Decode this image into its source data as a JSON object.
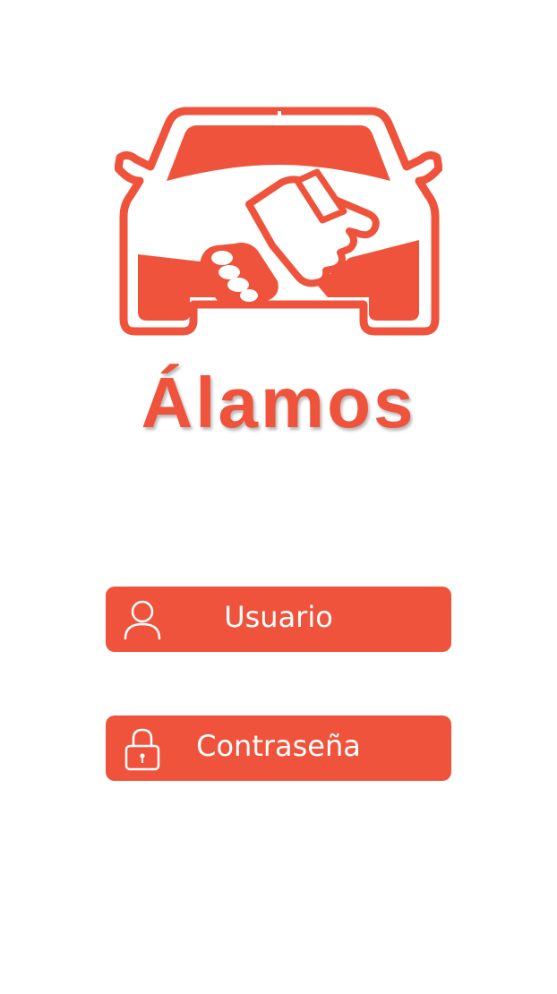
{
  "app": {
    "brand_name": "Álamos",
    "accent_color": "#ef533b",
    "logo_icon": "car-handshake-logo-icon"
  },
  "login": {
    "username": {
      "label": "Usuario",
      "icon": "user-icon"
    },
    "password": {
      "label": "Contraseña",
      "icon": "lock-icon"
    }
  }
}
